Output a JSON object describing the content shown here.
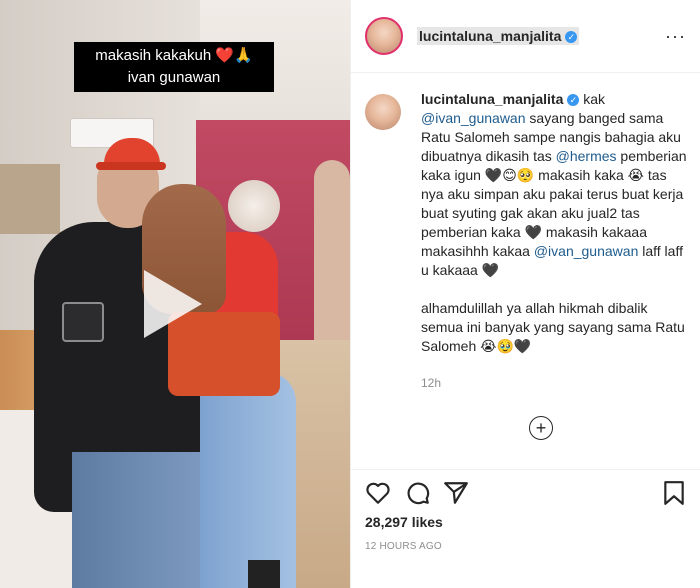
{
  "video": {
    "overlay_caption_line1": "makasih kakakuh ❤️🙏",
    "overlay_caption_line2": "ivan gunawan"
  },
  "header": {
    "username": "lucintaluna_manjalita",
    "verified_icon": "verified-badge-icon",
    "more_icon": "more-options-icon"
  },
  "caption": {
    "username": "lucintaluna_manjalita",
    "segments": [
      {
        "text": " kak ",
        "type": "text"
      },
      {
        "text": "@ivan_gunawan",
        "type": "mention"
      },
      {
        "text": " sayang banged sama Ratu Salomeh sampe nangis bahagia aku dibuatnya dikasih tas ",
        "type": "text"
      },
      {
        "text": "@hermes",
        "type": "mention"
      },
      {
        "text": " pemberian kaka igun 🖤😊🥺 makasih kaka 😭 tas nya aku simpan aku pakai terus buat kerja buat syuting gak akan aku jual2 tas pemberian kaka 🖤 makasih kakaaa makasihhh kakaa ",
        "type": "text"
      },
      {
        "text": "@ivan_gunawan",
        "type": "mention"
      },
      {
        "text": " laff laff u kakaaa 🖤\n\nalhamdulillah ya allah hikmah dibalik semua ini banyak yang sayang sama Ratu Salomeh 😭🥹🖤",
        "type": "text"
      }
    ],
    "time_ago": "12h"
  },
  "load_more_icon": "plus-circle-icon",
  "actions": {
    "like_icon": "heart-icon",
    "comment_icon": "comment-icon",
    "share_icon": "paper-plane-icon",
    "save_icon": "bookmark-icon"
  },
  "likes_text": "28,297 likes",
  "posted_time": "12 HOURS AGO",
  "colors": {
    "mention": "#1f5c8e",
    "verified": "#3897f0",
    "muted": "#8e8e8e"
  }
}
